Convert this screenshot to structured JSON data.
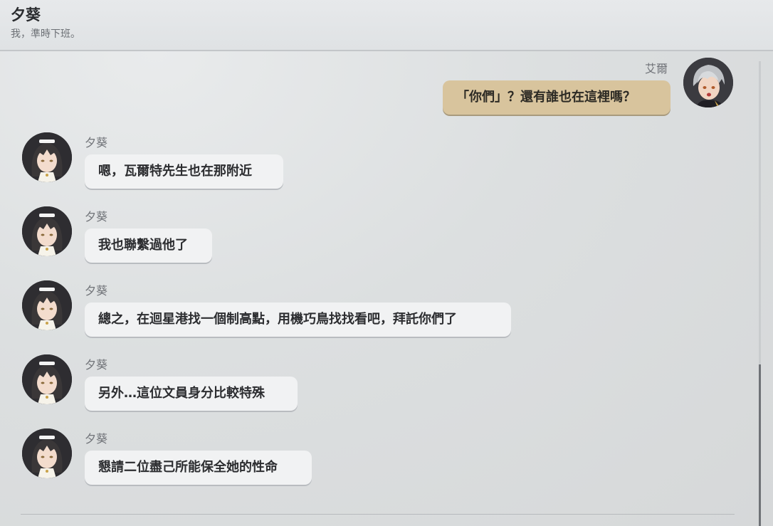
{
  "header": {
    "title": "夕葵",
    "subtitle": "我，準時下班。"
  },
  "colors": {
    "own_bubble": "#d8c49d",
    "other_bubble": "#f1f2f3",
    "text": "#2c2d30"
  },
  "messages": [
    {
      "sender": "艾爾",
      "text": "「你們」？還有誰也在這裡嗎？",
      "own": true,
      "avatar": "eir-avatar"
    },
    {
      "sender": "夕葵",
      "text": "嗯，瓦爾特先生也在那附近",
      "own": false,
      "avatar": "yuki-avatar"
    },
    {
      "sender": "夕葵",
      "text": "我也聯繫過他了",
      "own": false,
      "avatar": "yuki-avatar"
    },
    {
      "sender": "夕葵",
      "text": "總之，在迴星港找一個制高點，用機巧鳥找找看吧，拜託你們了",
      "own": false,
      "avatar": "yuki-avatar"
    },
    {
      "sender": "夕葵",
      "text": "另外…這位文員身分比較特殊",
      "own": false,
      "avatar": "yuki-avatar"
    },
    {
      "sender": "夕葵",
      "text": "懇請二位盡己所能保全她的性命",
      "own": false,
      "avatar": "yuki-avatar"
    }
  ]
}
